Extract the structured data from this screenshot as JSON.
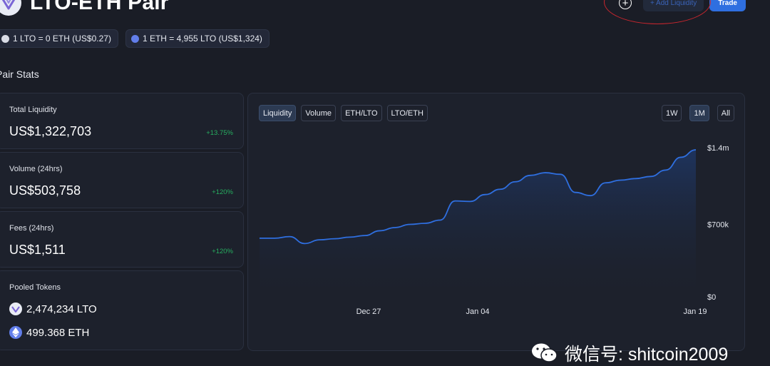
{
  "header": {
    "title": "LTO-ETH Pair",
    "add_liquidity_label": "+ Add Liquidity",
    "trade_label": "Trade"
  },
  "rates": [
    {
      "icon": "lto-icon",
      "text": "1 LTO = 0 ETH (US$0.27)"
    },
    {
      "icon": "eth-icon",
      "text": "1 ETH = 4,955 LTO (US$1,324)"
    }
  ],
  "stats": {
    "section_title": "Pair Stats",
    "total_liquidity": {
      "label": "Total Liquidity",
      "value": "US$1,322,703",
      "change": "+13.75%"
    },
    "volume": {
      "label": "Volume (24hrs)",
      "value": "US$503,758",
      "change": "+120%"
    },
    "fees": {
      "label": "Fees (24hrs)",
      "value": "US$1,511",
      "change": "+120%"
    },
    "pooled": {
      "label": "Pooled Tokens",
      "lto": "2,474,234 LTO",
      "eth": "499.368 ETH"
    }
  },
  "chart_tabs": [
    "Liquidity",
    "Volume",
    "ETH/LTO",
    "LTO/ETH"
  ],
  "active_tab": "Liquidity",
  "range_buttons": [
    "1W",
    "1M",
    "All"
  ],
  "active_range": "1M",
  "chart_data": {
    "type": "area",
    "series": [
      {
        "values": [
          550000,
          550000,
          565000,
          500000,
          535000,
          545000,
          560000,
          575000,
          620000,
          650000,
          680000,
          690000,
          720000,
          900000,
          895000,
          960000,
          1010000,
          1080000,
          1140000,
          1165000,
          1150000,
          980000,
          950000,
          1070000,
          1095000,
          1110000,
          1130000,
          1190000,
          1310000,
          1380000
        ]
      }
    ],
    "x_ticks": [
      "Dec 27",
      "Jan 04",
      "Jan 19"
    ],
    "y_ticks": [
      "$0",
      "$700k",
      "$1.4m"
    ],
    "ylim": [
      0,
      1400000
    ],
    "grid": false,
    "colors": {
      "line": "#2f6fe0",
      "fill": "#1e3766"
    }
  },
  "watermark": "微信号: shitcoin2009",
  "colors": {
    "positive": "#27ae60",
    "accent": "#2f6fe0",
    "annotation": "#c9262e"
  }
}
